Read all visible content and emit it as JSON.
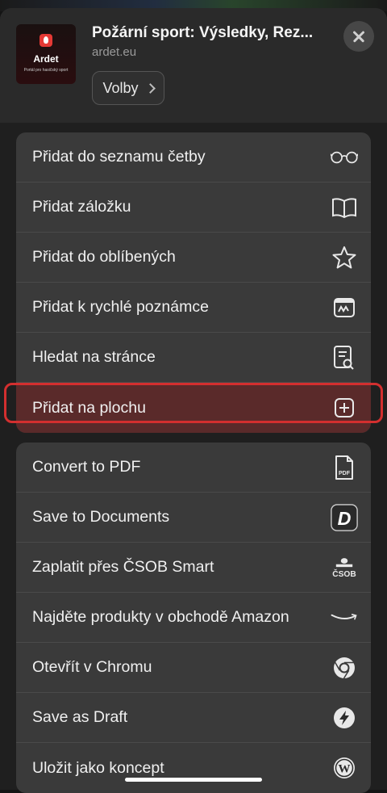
{
  "header": {
    "thumbnail_brand": "Ardet",
    "thumbnail_tagline": "Portál pro hasičský sport",
    "title": "Požární sport: Výsledky, Rez...",
    "domain": "ardet.eu",
    "options_label": "Volby"
  },
  "group1": [
    {
      "label": "Přidat do seznamu četby",
      "icon": "glasses-icon"
    },
    {
      "label": "Přidat záložku",
      "icon": "book-icon"
    },
    {
      "label": "Přidat do oblíbených",
      "icon": "star-icon"
    },
    {
      "label": "Přidat k rychlé poznámce",
      "icon": "quick-note-icon"
    },
    {
      "label": "Hledat na stránce",
      "icon": "find-on-page-icon"
    },
    {
      "label": "Přidat na plochu",
      "icon": "add-square-icon"
    }
  ],
  "group2": [
    {
      "label": "Convert to PDF",
      "icon": "pdf-icon",
      "icon_text": "PDF"
    },
    {
      "label": "Save to Documents",
      "icon": "documents-app-icon",
      "icon_text": "D"
    },
    {
      "label": "Zaplatit přes ČSOB Smart",
      "icon": "csob-icon",
      "icon_text": "ČSOB"
    },
    {
      "label": "Najděte produkty v obchodě Amazon",
      "icon": "amazon-icon"
    },
    {
      "label": "Otevřít v Chromu",
      "icon": "chrome-icon"
    },
    {
      "label": "Save as Draft",
      "icon": "lightning-icon"
    },
    {
      "label": "Uložit jako koncept",
      "icon": "wordpress-icon",
      "icon_text": "W"
    }
  ],
  "colors": {
    "highlight_ring": "#d32f2f",
    "row_background": "#3a3a3a",
    "header_background": "#2a2a2a"
  }
}
